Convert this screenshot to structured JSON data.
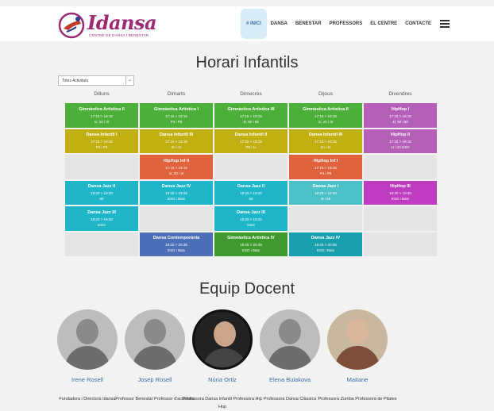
{
  "brand": {
    "name": "Idansa",
    "tagline": "CENTRE DE DANSA I BENESTAR",
    "color": "#9c2a74"
  },
  "nav": {
    "items": [
      {
        "label": "# INICI",
        "active": true
      },
      {
        "label": "DANSA",
        "active": false
      },
      {
        "label": "BENESTAR",
        "active": false
      },
      {
        "label": "PROFESSORS",
        "active": false
      },
      {
        "label": "EL CENTRE",
        "active": false
      },
      {
        "label": "CONTACTE",
        "active": false
      }
    ],
    "menu_icon": "hamburger-icon"
  },
  "schedule": {
    "title": "Horari Infantils",
    "filter": {
      "selected": "Totes Activitats",
      "icon": "chevron-down-icon"
    },
    "days": [
      "Dilluns",
      "Dimarts",
      "Dimecres",
      "Dijous",
      "Divendres"
    ],
    "rows": [
      [
        {
          "name": "Gimnàstica Artística II",
          "time": "17:15 > 18:15",
          "level": "1r, 2n i 3r",
          "color": "#4caf3a"
        },
        {
          "name": "Gimnàstica Artística I",
          "time": "17:15 > 18:15",
          "level": "P4 i P5",
          "color": "#4caf3a"
        },
        {
          "name": "Gimnàstica Artística III",
          "time": "17:15 > 18:15",
          "level": "4t, 5è i 6è",
          "color": "#4caf3a"
        },
        {
          "name": "Gimnàstica Artística II",
          "time": "17:15 > 18:15",
          "level": "1r, 2n i 3r",
          "color": "#4caf3a"
        },
        {
          "name": "HipHop I",
          "time": "17:15 > 18:15",
          "level": "4t, 5è i 6è",
          "color": "#b65fb8"
        }
      ],
      [
        {
          "name": "Dansa Infantil I",
          "time": "17:15 > 18:15",
          "level": "P3 i P4",
          "color": "#c2b012"
        },
        {
          "name": "Dansa Infantil III",
          "time": "17:15 > 18:15",
          "level": "2n i 3r",
          "color": "#c2b012"
        },
        {
          "name": "Dansa Infantil II",
          "time": "17:15 > 18:15",
          "level": "P5 i 1r",
          "color": "#c2b012"
        },
        {
          "name": "Dansa Infantil III",
          "time": "17:15 > 18:15",
          "level": "2n i 3r",
          "color": "#c2b012"
        },
        {
          "name": "HipHop II",
          "time": "17:15 > 18:15",
          "level": "1r i 2n ESO",
          "color": "#b65fb8"
        }
      ],
      [
        {
          "empty": true
        },
        {
          "name": "HipHop Inf II",
          "time": "17:15 > 18:15",
          "level": "1r, 2n i 3r",
          "color": "#e0633e"
        },
        {
          "empty": true
        },
        {
          "name": "HipHop Inf I",
          "time": "17:15 > 18:15",
          "level": "P4 i P5",
          "color": "#e0633e"
        },
        {
          "empty": true
        }
      ],
      [
        {
          "name": "Dansa Jazz II",
          "time": "18:20 > 19:20",
          "level": "6è",
          "color": "#1fb6c9"
        },
        {
          "name": "Dansa Jazz IV",
          "time": "18:20 > 19:35",
          "level": "ESO i Batx",
          "color": "#1fb6c9"
        },
        {
          "name": "Dansa Jazz II",
          "time": "18:20 > 19:20",
          "level": "6è",
          "color": "#1fb6c9"
        },
        {
          "name": "Dansa Jazz I",
          "time": "18:20 > 19:20",
          "level": "4t i 5è",
          "color": "#4cc1c7"
        },
        {
          "name": "HipHop III",
          "time": "18:30 > 19:30",
          "level": "ESO i Batx",
          "color": "#bf3bbf"
        }
      ],
      [
        {
          "name": "Dansa Jazz III",
          "time": "18:20 > 19:20",
          "level": "ESO",
          "color": "#1fb6c9"
        },
        {
          "empty": true
        },
        {
          "name": "Dansa Jazz III",
          "time": "18:20 > 19:20",
          "level": "ESO",
          "color": "#1fb6c9"
        },
        {
          "empty": true
        },
        {
          "empty": true
        }
      ],
      [
        {
          "empty": true
        },
        {
          "name": "Dansa Contemporània",
          "time": "19:20 > 20:35",
          "level": "ESO i Batx",
          "color": "#4d6fb8"
        },
        {
          "name": "Gimnàstica Artística IV",
          "time": "19:20 > 20:35",
          "level": "ESO i Batx",
          "color": "#3f9a2e"
        },
        {
          "name": "Dansa Jazz IV",
          "time": "19:20 > 20:35",
          "level": "ESO i Batx",
          "color": "#1a9fae"
        },
        {
          "empty": true
        }
      ]
    ]
  },
  "team": {
    "title": "Equip Docent",
    "members": [
      {
        "name": "Irene Rosell",
        "role": "Fundadora i Directora Idansa",
        "style": "bw"
      },
      {
        "name": "Josep Rosell",
        "role": "Professor Benestar Professor d'activitats",
        "style": "bw"
      },
      {
        "name": "Núria Ortiz",
        "role": "Professora Dansa Infantil Professora Hip Hop",
        "style": "dark"
      },
      {
        "name": "Elena Bulakova",
        "role": "Professora Dansa Clàssica",
        "style": "bw"
      },
      {
        "name": "Maitane",
        "role": "Professora Zumba Professora de Pilates",
        "style": "color"
      }
    ]
  }
}
